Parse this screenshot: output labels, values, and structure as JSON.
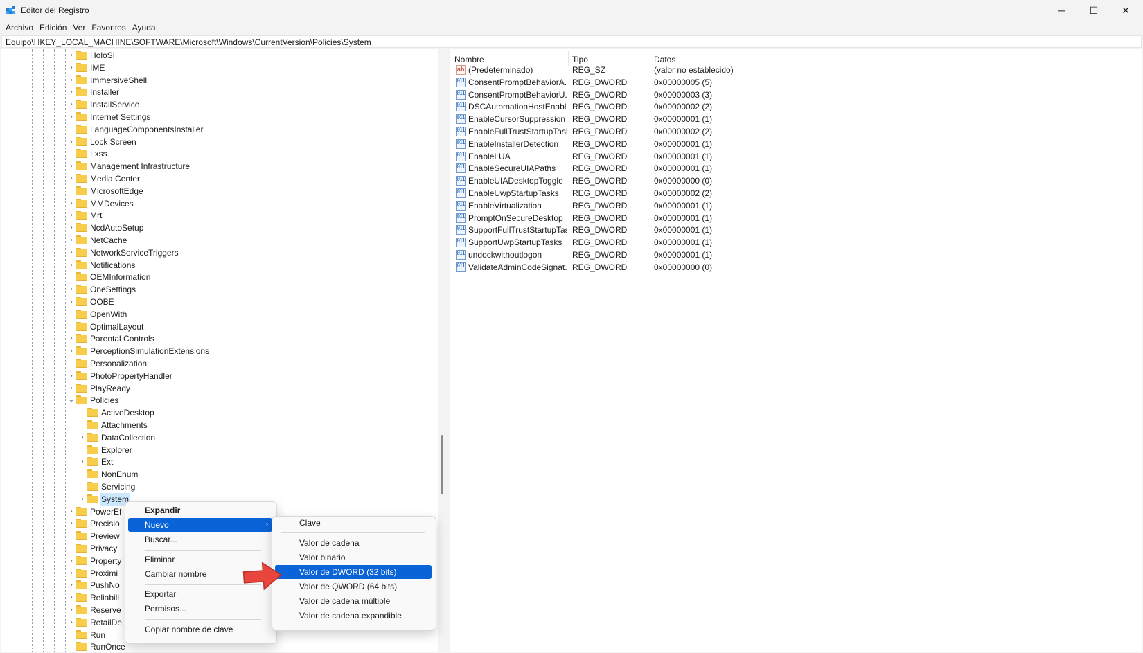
{
  "window": {
    "title": "Editor del Registro",
    "minimize_glyph": "─",
    "maximize_glyph": "☐",
    "close_glyph": "✕"
  },
  "menu": [
    "Archivo",
    "Edición",
    "Ver",
    "Favoritos",
    "Ayuda"
  ],
  "address": "Equipo\\HKEY_LOCAL_MACHINE\\SOFTWARE\\Microsoft\\Windows\\CurrentVersion\\Policies\\System",
  "tree": [
    {
      "label": "HoloSI",
      "level": 0,
      "chevron": "›"
    },
    {
      "label": "IME",
      "level": 0,
      "chevron": "›"
    },
    {
      "label": "ImmersiveShell",
      "level": 0,
      "chevron": "›"
    },
    {
      "label": "Installer",
      "level": 0,
      "chevron": "›"
    },
    {
      "label": "InstallService",
      "level": 0,
      "chevron": "›"
    },
    {
      "label": "Internet Settings",
      "level": 0,
      "chevron": "›"
    },
    {
      "label": "LanguageComponentsInstaller",
      "level": 0,
      "chevron": ""
    },
    {
      "label": "Lock Screen",
      "level": 0,
      "chevron": "›"
    },
    {
      "label": "Lxss",
      "level": 0,
      "chevron": ""
    },
    {
      "label": "Management Infrastructure",
      "level": 0,
      "chevron": "›"
    },
    {
      "label": "Media Center",
      "level": 0,
      "chevron": "›"
    },
    {
      "label": "MicrosoftEdge",
      "level": 0,
      "chevron": ""
    },
    {
      "label": "MMDevices",
      "level": 0,
      "chevron": "›"
    },
    {
      "label": "Mrt",
      "level": 0,
      "chevron": "›"
    },
    {
      "label": "NcdAutoSetup",
      "level": 0,
      "chevron": "›"
    },
    {
      "label": "NetCache",
      "level": 0,
      "chevron": "›"
    },
    {
      "label": "NetworkServiceTriggers",
      "level": 0,
      "chevron": "›"
    },
    {
      "label": "Notifications",
      "level": 0,
      "chevron": "›"
    },
    {
      "label": "OEMInformation",
      "level": 0,
      "chevron": ""
    },
    {
      "label": "OneSettings",
      "level": 0,
      "chevron": "›"
    },
    {
      "label": "OOBE",
      "level": 0,
      "chevron": "›"
    },
    {
      "label": "OpenWith",
      "level": 0,
      "chevron": ""
    },
    {
      "label": "OptimalLayout",
      "level": 0,
      "chevron": ""
    },
    {
      "label": "Parental Controls",
      "level": 0,
      "chevron": "›"
    },
    {
      "label": "PerceptionSimulationExtensions",
      "level": 0,
      "chevron": "›"
    },
    {
      "label": "Personalization",
      "level": 0,
      "chevron": ""
    },
    {
      "label": "PhotoPropertyHandler",
      "level": 0,
      "chevron": "›"
    },
    {
      "label": "PlayReady",
      "level": 0,
      "chevron": "›"
    },
    {
      "label": "Policies",
      "level": 0,
      "chevron": "⌄"
    },
    {
      "label": "ActiveDesktop",
      "level": 1,
      "chevron": ""
    },
    {
      "label": "Attachments",
      "level": 1,
      "chevron": ""
    },
    {
      "label": "DataCollection",
      "level": 1,
      "chevron": "›"
    },
    {
      "label": "Explorer",
      "level": 1,
      "chevron": ""
    },
    {
      "label": "Ext",
      "level": 1,
      "chevron": "›"
    },
    {
      "label": "NonEnum",
      "level": 1,
      "chevron": ""
    },
    {
      "label": "Servicing",
      "level": 1,
      "chevron": ""
    },
    {
      "label": "System",
      "level": 1,
      "chevron": "›",
      "selected": true
    },
    {
      "label": "PowerEf",
      "level": 0,
      "chevron": "›"
    },
    {
      "label": "Precisio",
      "level": 0,
      "chevron": "›"
    },
    {
      "label": "Preview",
      "level": 0,
      "chevron": ""
    },
    {
      "label": "Privacy",
      "level": 0,
      "chevron": ""
    },
    {
      "label": "Property",
      "level": 0,
      "chevron": "›"
    },
    {
      "label": "Proximi",
      "level": 0,
      "chevron": "›"
    },
    {
      "label": "PushNo",
      "level": 0,
      "chevron": "›"
    },
    {
      "label": "Reliabili",
      "level": 0,
      "chevron": "›"
    },
    {
      "label": "Reserve",
      "level": 0,
      "chevron": "›"
    },
    {
      "label": "RetailDe",
      "level": 0,
      "chevron": "›"
    },
    {
      "label": "Run",
      "level": 0,
      "chevron": ""
    },
    {
      "label": "RunOnce",
      "level": 0,
      "chevron": ""
    }
  ],
  "list_headers": {
    "name": "Nombre",
    "type": "Tipo",
    "data": "Datos"
  },
  "values": [
    {
      "name": "(Predeterminado)",
      "type": "REG_SZ",
      "data": "(valor no establecido)",
      "icon": "ab"
    },
    {
      "name": "ConsentPromptBehaviorA...",
      "type": "REG_DWORD",
      "data": "0x00000005 (5)",
      "icon": "011"
    },
    {
      "name": "ConsentPromptBehaviorU...",
      "type": "REG_DWORD",
      "data": "0x00000003 (3)",
      "icon": "011"
    },
    {
      "name": "DSCAutomationHostEnabl...",
      "type": "REG_DWORD",
      "data": "0x00000002 (2)",
      "icon": "011"
    },
    {
      "name": "EnableCursorSuppression",
      "type": "REG_DWORD",
      "data": "0x00000001 (1)",
      "icon": "011"
    },
    {
      "name": "EnableFullTrustStartupTasks",
      "type": "REG_DWORD",
      "data": "0x00000002 (2)",
      "icon": "011"
    },
    {
      "name": "EnableInstallerDetection",
      "type": "REG_DWORD",
      "data": "0x00000001 (1)",
      "icon": "011"
    },
    {
      "name": "EnableLUA",
      "type": "REG_DWORD",
      "data": "0x00000001 (1)",
      "icon": "011"
    },
    {
      "name": "EnableSecureUIAPaths",
      "type": "REG_DWORD",
      "data": "0x00000001 (1)",
      "icon": "011"
    },
    {
      "name": "EnableUIADesktopToggle",
      "type": "REG_DWORD",
      "data": "0x00000000 (0)",
      "icon": "011"
    },
    {
      "name": "EnableUwpStartupTasks",
      "type": "REG_DWORD",
      "data": "0x00000002 (2)",
      "icon": "011"
    },
    {
      "name": "EnableVirtualization",
      "type": "REG_DWORD",
      "data": "0x00000001 (1)",
      "icon": "011"
    },
    {
      "name": "PromptOnSecureDesktop",
      "type": "REG_DWORD",
      "data": "0x00000001 (1)",
      "icon": "011"
    },
    {
      "name": "SupportFullTrustStartupTasks",
      "type": "REG_DWORD",
      "data": "0x00000001 (1)",
      "icon": "011"
    },
    {
      "name": "SupportUwpStartupTasks",
      "type": "REG_DWORD",
      "data": "0x00000001 (1)",
      "icon": "011"
    },
    {
      "name": "undockwithoutlogon",
      "type": "REG_DWORD",
      "data": "0x00000001 (1)",
      "icon": "011"
    },
    {
      "name": "ValidateAdminCodeSignat...",
      "type": "REG_DWORD",
      "data": "0x00000000 (0)",
      "icon": "011"
    }
  ],
  "context_menu": {
    "expand": "Expandir",
    "new": "Nuevo",
    "new_arrow": "›",
    "find": "Buscar...",
    "delete": "Eliminar",
    "rename": "Cambiar nombre",
    "export": "Exportar",
    "permissions": "Permisos...",
    "copy_key_name": "Copiar nombre de clave"
  },
  "submenu": {
    "key": "Clave",
    "string": "Valor de cadena",
    "binary": "Valor binario",
    "dword": "Valor de DWORD (32 bits)",
    "qword": "Valor de QWORD (64 bits)",
    "multi_string": "Valor de cadena múltiple",
    "expandable_string": "Valor de cadena expandible"
  },
  "colors": {
    "highlight": "#0a64d8",
    "selection": "#cce8ff",
    "arrow": "#e8453c"
  }
}
